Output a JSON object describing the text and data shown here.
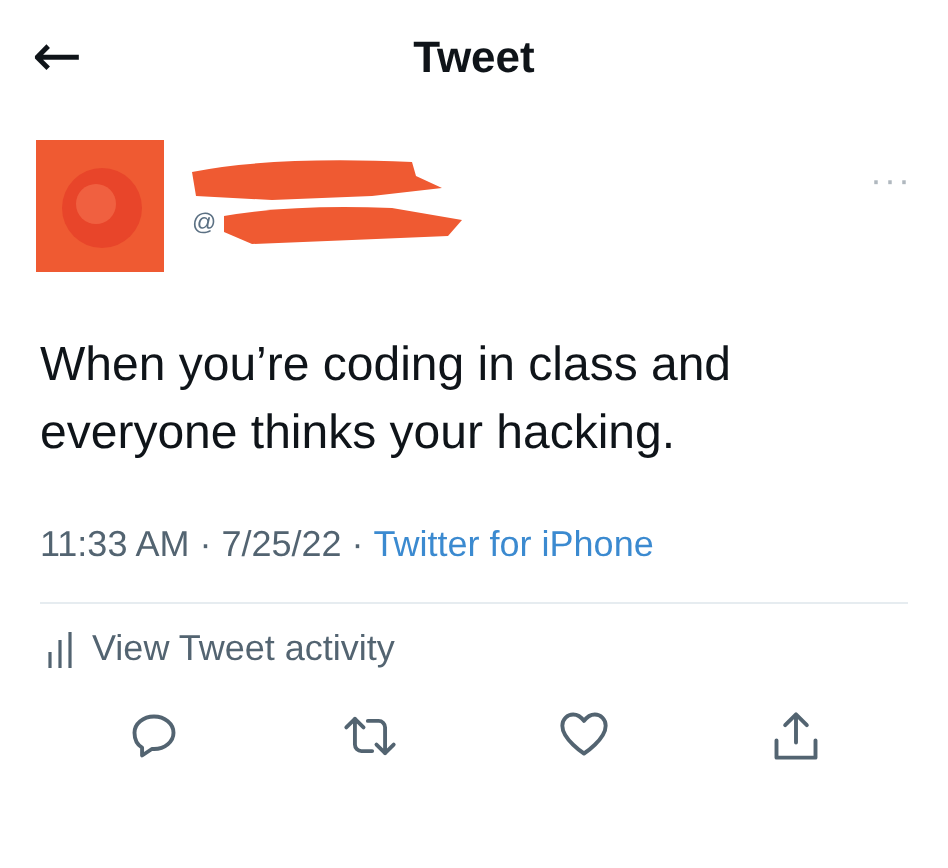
{
  "header": {
    "back": "←",
    "title": "Tweet"
  },
  "author": {
    "handle": "@",
    "redacted": true
  },
  "more": "···",
  "tweet": {
    "text": "When you’re coding in class and everyone thinks your hacking."
  },
  "meta": {
    "time": "11:33 AM",
    "separator_1": "·",
    "date": "7/25/22",
    "separator_2": "·",
    "source": "Twitter for iPhone"
  },
  "activity": {
    "label": "View Tweet activity"
  },
  "actions": [
    {
      "kind": "reply"
    },
    {
      "kind": "retweet"
    },
    {
      "kind": "like"
    },
    {
      "kind": "share"
    }
  ]
}
